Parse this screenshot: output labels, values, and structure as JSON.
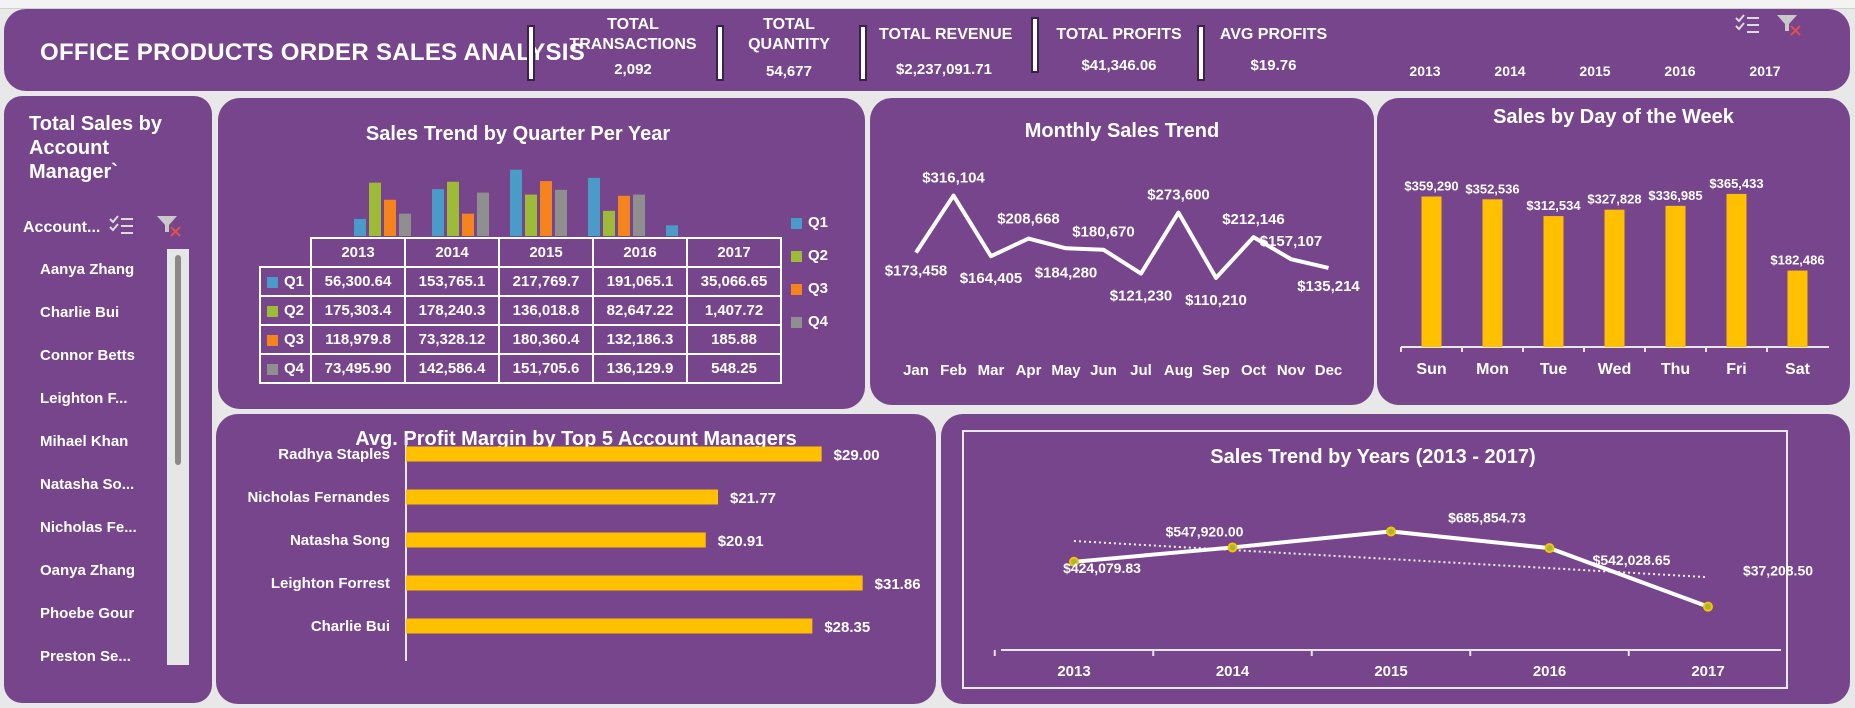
{
  "header": {
    "title": "OFFICE PRODUCTS ORDER SALES ANALYSIS",
    "kpis": [
      {
        "label_line1": "TOTAL",
        "label_line2": "TRANSACTIONS",
        "value": "2,092"
      },
      {
        "label_line1": "TOTAL",
        "label_line2": "QUANTITY",
        "value": "54,677"
      },
      {
        "label": "TOTAL REVENUE",
        "value": "$2,237,091.71"
      },
      {
        "label": "TOTAL PROFITS",
        "value": "$41,346.06"
      },
      {
        "label": "AVG PROFITS",
        "value": "$19.76"
      }
    ],
    "year_slicer": [
      "2013",
      "2014",
      "2015",
      "2016",
      "2017"
    ],
    "slicer_icons": [
      "multiselect-icon",
      "clear-filter-icon"
    ]
  },
  "managers_panel": {
    "title": "Total Sales by Account Manager`",
    "title_lines": [
      "Total Sales by",
      "Account",
      "Manager`"
    ],
    "slicer_header": "Account...",
    "items": [
      "Aanya Zhang",
      "Charlie Bui",
      "Connor Betts",
      "Leighton F...",
      "Mihael Khan",
      "Natasha So...",
      "Nicholas Fe...",
      "Oanya Zhang",
      "Phoebe Gour",
      "Preston Se..."
    ]
  },
  "colors": {
    "panel": "#76458c",
    "accent_gold": "#ffc000",
    "q1": "#4b9bc9",
    "q2": "#9dbb36",
    "q3": "#f5841f",
    "q4": "#8f8f8f"
  },
  "chart_data": [
    {
      "type": "bar",
      "title": "Sales Trend by Quarter Per Year",
      "categories": [
        "2013",
        "2014",
        "2015",
        "2016",
        "2017"
      ],
      "series": [
        {
          "name": "Q1",
          "values": [
            56300.64,
            153765.1,
            217769.7,
            191065.1,
            35066.65
          ],
          "labels": [
            "56,300.64",
            "153,765.1",
            "217,769.7",
            "191,065.1",
            "35,066.65"
          ]
        },
        {
          "name": "Q2",
          "values": [
            175303.4,
            178240.3,
            136018.8,
            82647.22,
            1407.72
          ],
          "labels": [
            "175,303.4",
            "178,240.3",
            "136,018.8",
            "82,647.22",
            "1,407.72"
          ]
        },
        {
          "name": "Q3",
          "values": [
            118979.8,
            73328.12,
            180360.4,
            132186.3,
            185.88
          ],
          "labels": [
            "118,979.8",
            "73,328.12",
            "180,360.4",
            "132,186.3",
            "185.88"
          ]
        },
        {
          "name": "Q4",
          "values": [
            73495.9,
            142586.4,
            151705.6,
            136129.9,
            548.25
          ],
          "labels": [
            "73,495.90",
            "142,586.4",
            "151,705.6",
            "136,129.9",
            "548.25"
          ]
        }
      ],
      "ylim": [
        0,
        230000
      ],
      "legend": "right"
    },
    {
      "type": "line",
      "title": "Monthly Sales Trend",
      "x": [
        "Jan",
        "Feb",
        "Mar",
        "Apr",
        "May",
        "Jun",
        "Jul",
        "Aug",
        "Sep",
        "Oct",
        "Nov",
        "Dec"
      ],
      "values": [
        173458,
        316104,
        164405,
        208668,
        184280,
        180670,
        121230,
        273600,
        110210,
        212146,
        157107,
        135214
      ],
      "labels": [
        "$173,458",
        "$316,104",
        "$164,405",
        "$208,668",
        "$184,280",
        "$180,670",
        "$121,230",
        "$273,600",
        "$110,210",
        "$212,146",
        "$157,107",
        "$135,214"
      ],
      "ylim": [
        60000,
        360000
      ]
    },
    {
      "type": "bar",
      "title": "Sales by Day of the Week",
      "categories": [
        "Sun",
        "Mon",
        "Tue",
        "Wed",
        "Thu",
        "Fri",
        "Sat"
      ],
      "values": [
        359290,
        352536,
        312534,
        327828,
        336985,
        365433,
        182486
      ],
      "labels": [
        "$359,290",
        "$352,536",
        "$312,534",
        "$327,828",
        "$336,985",
        "$365,433",
        "$182,486"
      ],
      "ylim": [
        0,
        370000
      ]
    },
    {
      "type": "bar",
      "orientation": "horizontal",
      "title": "Avg. Profit Margin by Top 5 Account Managers",
      "categories": [
        "Radhya Staples",
        "Nicholas Fernandes",
        "Natasha Song",
        "Leighton Forrest",
        "Charlie Bui"
      ],
      "values": [
        29.0,
        21.77,
        20.91,
        31.86,
        28.35
      ],
      "labels": [
        "$29.00",
        "$21.77",
        "$20.91",
        "$31.86",
        "$28.35"
      ],
      "xlim": [
        0,
        33
      ]
    },
    {
      "type": "line",
      "title": "Sales Trend by Years (2013 - 2017)",
      "x": [
        "2013",
        "2014",
        "2015",
        "2016",
        "2017"
      ],
      "values": [
        424079.83,
        547920.0,
        685854.73,
        542028.65,
        37208.5
      ],
      "labels": [
        "$424,079.83",
        "$547,920.00",
        "$685,854.73",
        "$542,028.65",
        "$37,208.50"
      ],
      "ylim": [
        0,
        750000
      ],
      "trendline": true
    }
  ]
}
